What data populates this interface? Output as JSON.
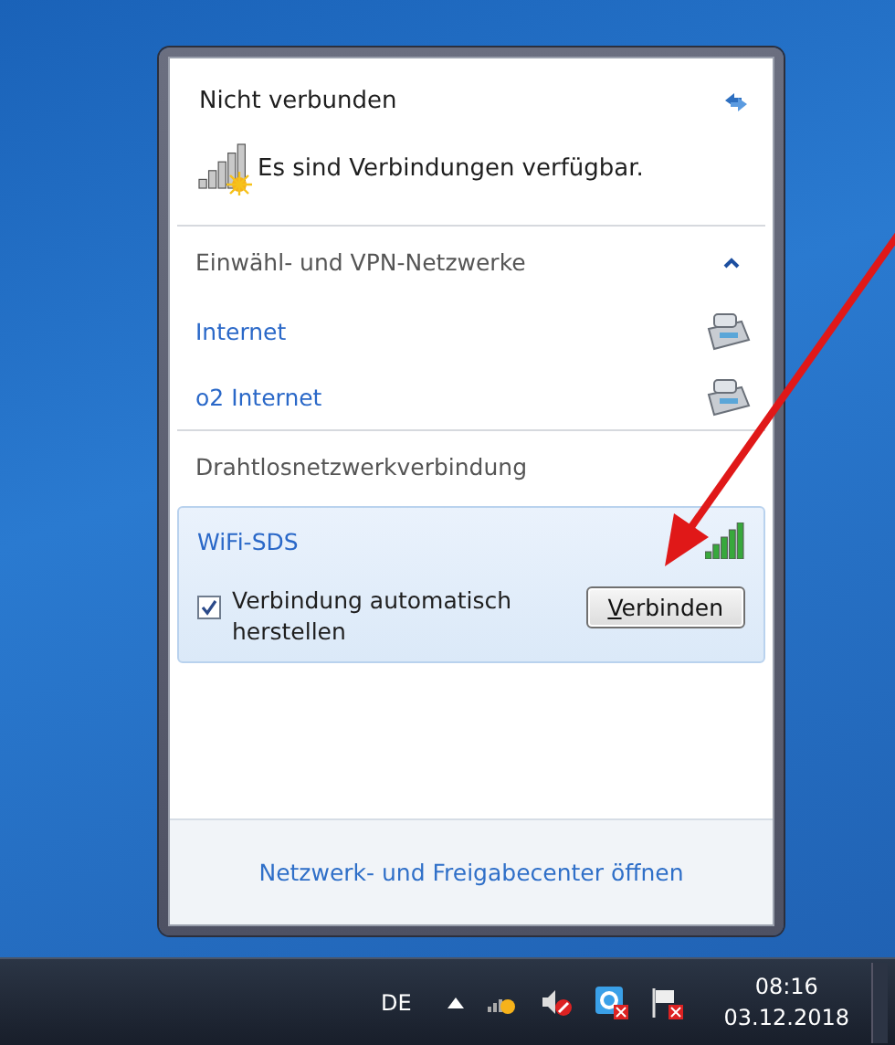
{
  "flyout": {
    "status_title": "Nicht verbunden",
    "status_message": "Es sind Verbindungen verfügbar.",
    "groups": [
      {
        "title": "Einwähl- und VPN-Netzwerke",
        "expanded": true,
        "items": [
          {
            "kind": "dialup",
            "name": "Internet",
            "selected": false
          },
          {
            "kind": "dialup",
            "name": "o2 Internet",
            "selected": false
          }
        ]
      },
      {
        "title": "Drahtlosnetzwerkverbindung",
        "items": [
          {
            "kind": "wireless",
            "name": "WiFi-SDS",
            "selected": true,
            "auto_connect_label": "Verbindung automatisch herstellen",
            "auto_connect": true,
            "connect_button": "Verbinden"
          }
        ]
      }
    ],
    "footer_link": "Netzwerk- und Freigabecenter öffnen"
  },
  "taskbar": {
    "language": "DE",
    "time": "08:16",
    "date": "03.12.2018"
  }
}
